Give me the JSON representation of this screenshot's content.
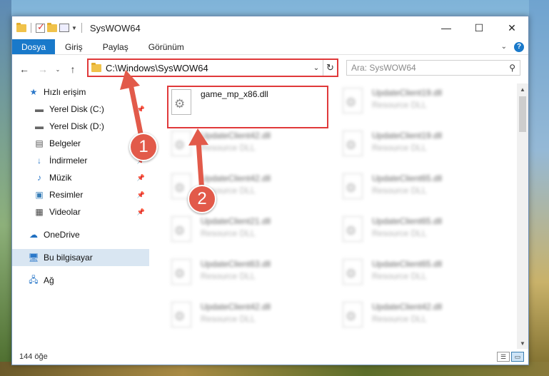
{
  "window": {
    "title": "SysWOW64",
    "controls": {
      "minimize": "—",
      "maximize": "☐",
      "close": "✕"
    }
  },
  "ribbon": {
    "tabs": [
      "Dosya",
      "Giriş",
      "Paylaş",
      "Görünüm"
    ],
    "help": "?"
  },
  "address": {
    "path": "C:\\Windows\\SysWOW64"
  },
  "search": {
    "placeholder": "Ara: SysWOW64"
  },
  "sidebar": {
    "quick_access": "Hızlı erişim",
    "items": [
      {
        "label": "Yerel Disk (C:)",
        "icon": "drive-icon",
        "pinned": true
      },
      {
        "label": "Yerel Disk (D:)",
        "icon": "drive-icon",
        "pinned": false
      },
      {
        "label": "Belgeler",
        "icon": "documents-icon",
        "pinned": true
      },
      {
        "label": "İndirmeler",
        "icon": "download-icon",
        "pinned": true
      },
      {
        "label": "Müzik",
        "icon": "music-icon",
        "pinned": true
      },
      {
        "label": "Resimler",
        "icon": "pictures-icon",
        "pinned": true
      },
      {
        "label": "Videolar",
        "icon": "videos-icon",
        "pinned": true
      }
    ],
    "onedrive": "OneDrive",
    "this_pc": "Bu bilgisayar",
    "network": "Ağ"
  },
  "files": {
    "highlighted": {
      "name": "game_mp_x86.dll"
    },
    "col1": [
      {
        "name": "UpdateClient42.dll",
        "desc": "Resource DLL"
      },
      {
        "name": "UpdateClient42.dll",
        "desc": "Resource DLL"
      },
      {
        "name": "UpdateClient21.dll",
        "desc": "Resource DLL"
      },
      {
        "name": "UpdateClient63.dll",
        "desc": "Resource DLL"
      },
      {
        "name": "UpdateClient42.dll",
        "desc": "Resource DLL"
      }
    ],
    "col2": [
      {
        "name": "UpdateClient19.dll",
        "desc": "Resource DLL"
      },
      {
        "name": "UpdateClient19.dll",
        "desc": "Resource DLL"
      },
      {
        "name": "UpdateClient65.dll",
        "desc": "Resource DLL"
      },
      {
        "name": "UpdateClient65.dll",
        "desc": "Resource DLL"
      },
      {
        "name": "UpdateClient65.dll",
        "desc": "Resource DLL"
      },
      {
        "name": "UpdateClient42.dll",
        "desc": "Resource DLL"
      }
    ]
  },
  "status": {
    "count": "144 öğe"
  },
  "annotations": {
    "step1": "1",
    "step2": "2",
    "color": "#e25a4a"
  }
}
